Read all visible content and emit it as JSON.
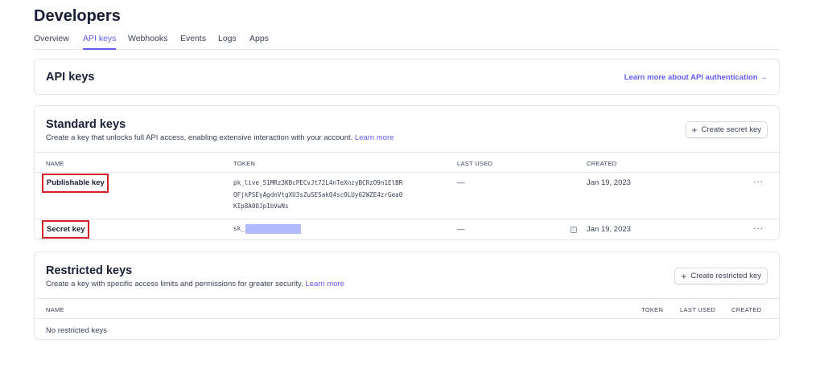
{
  "page": {
    "title": "Developers"
  },
  "tabs": [
    {
      "label": "Overview",
      "active": false
    },
    {
      "label": "API keys",
      "active": true
    },
    {
      "label": "Webhooks",
      "active": false
    },
    {
      "label": "Events",
      "active": false
    },
    {
      "label": "Logs",
      "active": false
    },
    {
      "label": "Apps",
      "active": false
    }
  ],
  "api_keys_header": {
    "title": "API keys",
    "learn_link": "Learn more about API authentication",
    "arrow_icon": "arrow-right-icon"
  },
  "standard": {
    "title": "Standard keys",
    "description": "Create a key that unlocks full API access, enabling extensive interaction with your account.",
    "learn_more": "Learn more",
    "create_button": "Create secret key",
    "columns": [
      "NAME",
      "TOKEN",
      "LAST USED",
      "CREATED"
    ],
    "rows": [
      {
        "name": "Publishable key",
        "token": "pk_live_51MRz3KBcPECvJt72L4nTeXnzyBCRzO9n1ElBR\nQFjkPSEyAgdnVtgXU3sZuSESakQ4scOLUy62WZE4zrGea0\nKIp8A00Jp1bVwNs",
        "last_used": "—",
        "created": "Jan 19, 2023",
        "more": "···"
      },
      {
        "name": "Secret key",
        "token": "sk_",
        "last_used": "—",
        "created": "Jan 19, 2023",
        "more": "···"
      }
    ]
  },
  "restricted": {
    "title": "Restricted keys",
    "description": "Create a key with specific access limits and permissions for greater security.",
    "learn_more": "Learn more",
    "create_button": "Create restricted key",
    "columns": [
      "NAME",
      "TOKEN",
      "LAST USED",
      "CREATED"
    ],
    "empty": "No restricted keys"
  },
  "colors": {
    "accent": "#635bff",
    "highlight": "#d3202b",
    "redact": "#b3b9ff"
  }
}
